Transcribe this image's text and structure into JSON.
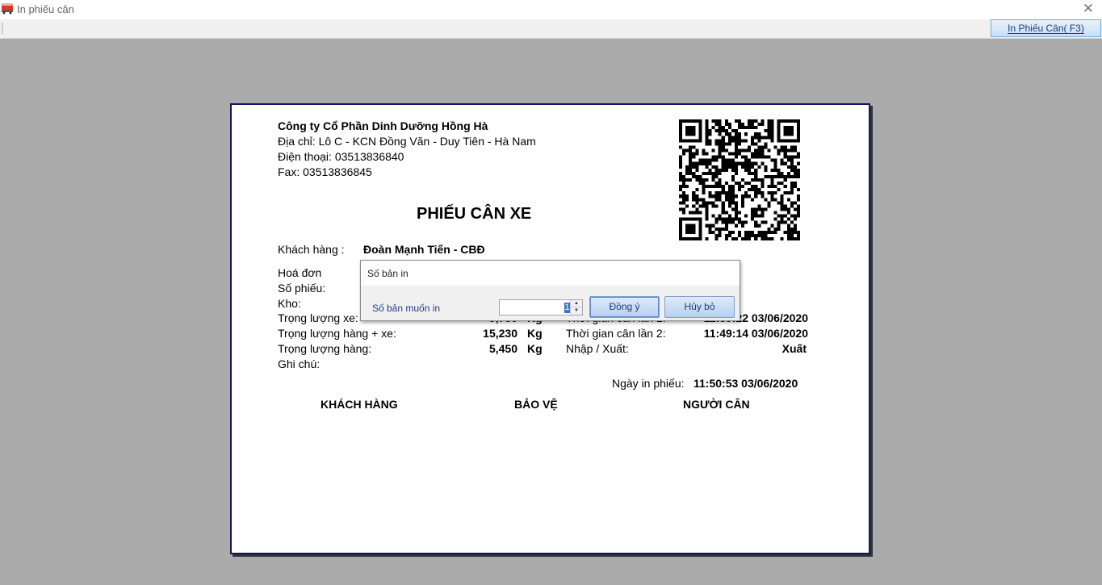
{
  "window": {
    "title": "In phiếu cân",
    "close_glyph": "✕"
  },
  "toolbar": {
    "print_label": "In Phiếu Cân( F3)"
  },
  "ticket": {
    "company_name": "Công ty Cổ Phần Dinh Dưỡng Hồng Hà",
    "address": "Địa chỉ: Lô C - KCN Đồng Văn - Duy Tiên - Hà Nam",
    "phone": "Điện thoại: 03513836840",
    "fax": "Fax: 03513836845",
    "title": "PHIẾU CÂN XE",
    "customer_label": "Khách hàng :",
    "customer_value": "Đoàn Mạnh Tiến - CBĐ",
    "invoice_label": "Hoá đơn",
    "ticket_no_label": "Số phiếu:",
    "warehouse_label": "Kho:",
    "vehicle_weight_label": "Trọng lượng xe:",
    "vehicle_weight_value": "9,780",
    "gross_weight_label": "Trọng lượng hàng + xe:",
    "gross_weight_value": "15,230",
    "goods_weight_label": "Trọng lượng hàng:",
    "goods_weight_value": "5,450",
    "unit": "Kg",
    "weigh_time1_label": "Thời gian cân lần 1:",
    "weigh_time1_value": "11:39:22 03/06/2020",
    "weigh_time2_label": "Thời gian cân lần 2:",
    "weigh_time2_value": "11:49:14 03/06/2020",
    "inout_label": "Nhập / Xuất:",
    "inout_value": "Xuất",
    "note_label": "Ghi chú:",
    "print_date_label": "Ngày in phiếu:",
    "print_date_value": "11:50:53 03/06/2020",
    "sign_customer": "KHÁCH HÀNG",
    "sign_guard": "BẢO VỆ",
    "sign_weigher": "NGƯỜI CÂN"
  },
  "dialog": {
    "title": "Số bản in",
    "label": "Số bản muốn in",
    "copies_value": "1",
    "ok_label": "Đồng ý",
    "cancel_label": "Hủy bỏ"
  },
  "colors": {
    "background": "#ababab",
    "paper_border": "#141466",
    "button_text": "#1c3d7a",
    "dialog_label": "#1f3f88"
  }
}
